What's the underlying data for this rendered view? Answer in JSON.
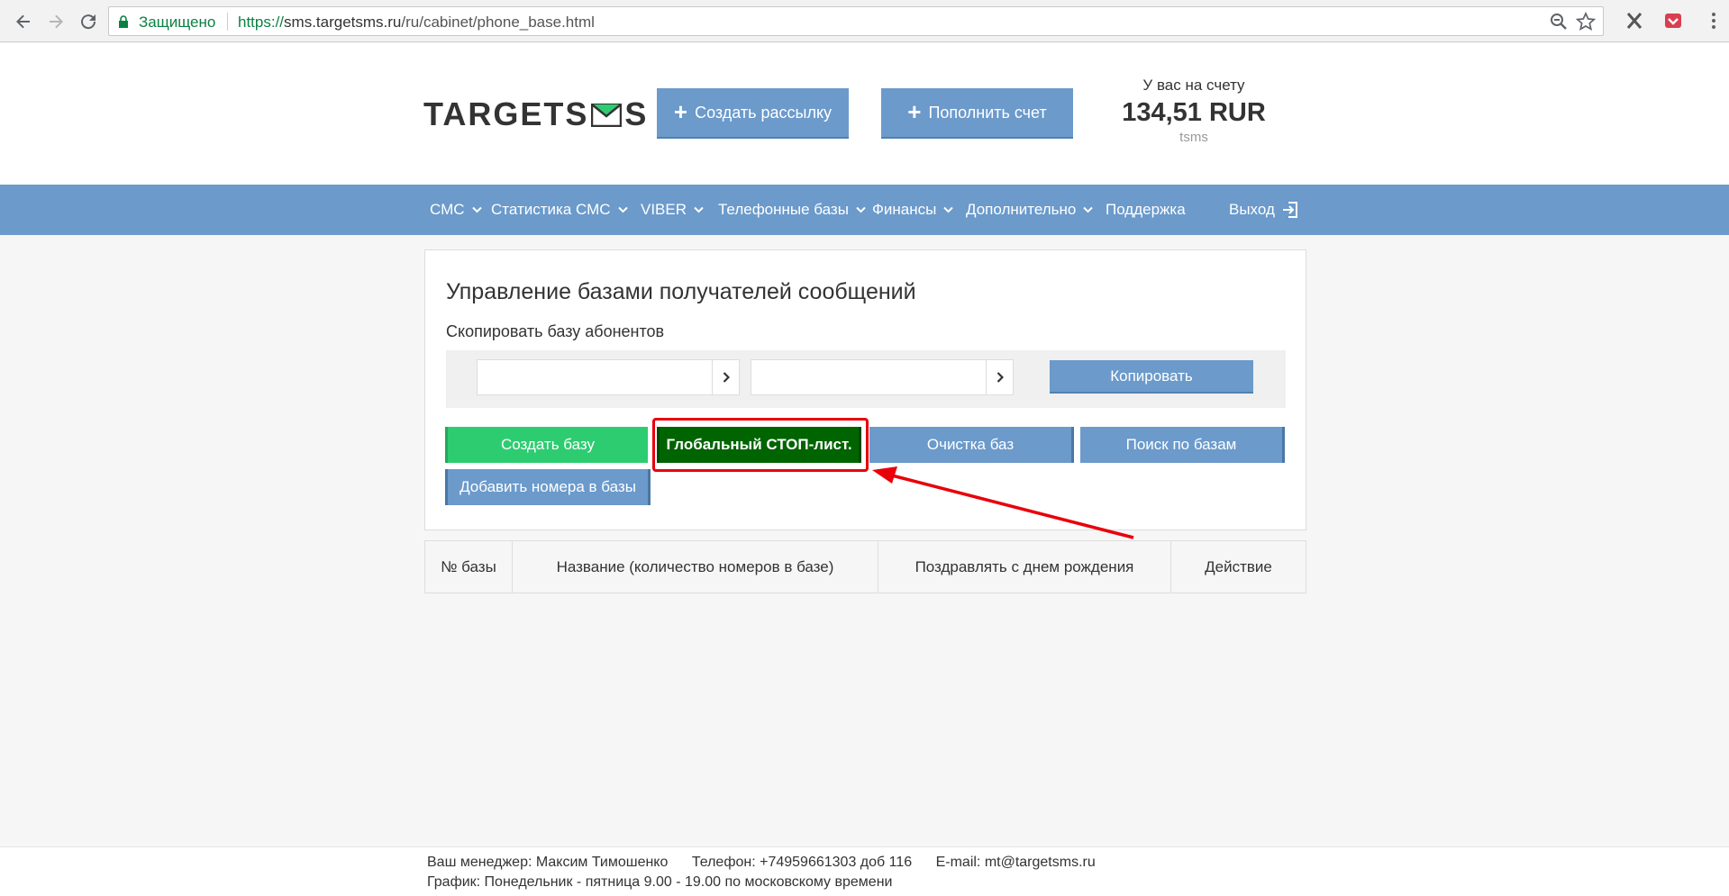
{
  "browser": {
    "secure_label": "Защищено",
    "url_scheme": "https://",
    "url_host": "sms.targetsms.ru",
    "url_path": "/ru/cabinet/phone_base.html"
  },
  "header": {
    "logo_left": "TARGETS",
    "logo_right": "S",
    "create_mailing": "Создать рассылку",
    "top_up": "Пополнить счет",
    "balance_label": "У вас на счету",
    "balance_amount": "134,51 RUR",
    "login": "tsms"
  },
  "nav": {
    "items": [
      {
        "label": "СМС",
        "dropdown": true
      },
      {
        "label": "Статистика СМС",
        "dropdown": true
      },
      {
        "label": "VIBER",
        "dropdown": true
      },
      {
        "label": "Телефонные базы",
        "dropdown": true
      },
      {
        "label": "Финансы",
        "dropdown": true
      },
      {
        "label": "Дополнительно",
        "dropdown": true
      },
      {
        "label": "Поддержка",
        "dropdown": false
      }
    ],
    "logout": "Выход"
  },
  "panel": {
    "title": "Управление базами получателей сообщений",
    "copy_section_title": "Скопировать базу абонентов",
    "copy_button": "Копировать",
    "actions": {
      "create_base": "Создать базу",
      "global_stop": "Глобальный СТОП-лист.",
      "clear_bases": "Очистка баз",
      "search_bases": "Поиск по базам",
      "add_numbers": "Добавить номера в базы"
    }
  },
  "table": {
    "columns": [
      "№ базы",
      "Название (количество номеров в базе)",
      "Поздравлять с днем рождения",
      "Действие"
    ]
  },
  "footer": {
    "manager": "Ваш менеджер: Максим Тимошенко",
    "phone": "Телефон: +74959661303 доб 116",
    "email": "E-mail: mt@targetsms.ru",
    "schedule": "График: Понедельник - пятница 9.00 - 19.00 по московскому времени"
  },
  "colors": {
    "brand_blue": "#6b9acb",
    "green": "#2ecc71",
    "dark_green": "#006400",
    "annotation_red": "#e8000b"
  }
}
